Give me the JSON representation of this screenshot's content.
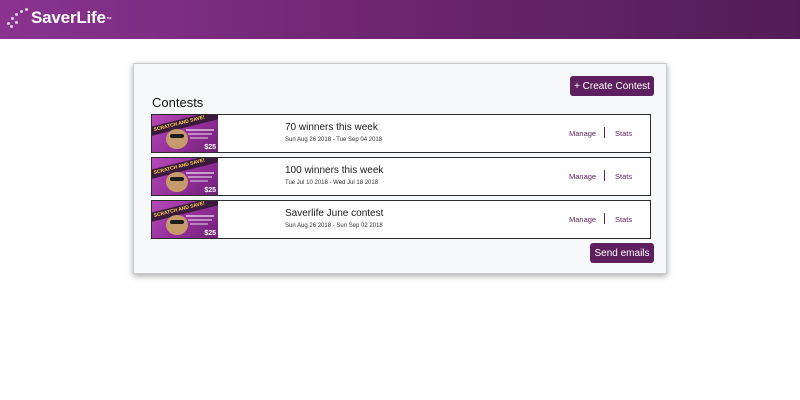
{
  "header": {
    "logo_text": "SaverLife",
    "logo_tm": "™",
    "brand_color": "#6f2672"
  },
  "main": {
    "title": "Contests",
    "create_button_label": "+ Create Contest",
    "send_button_label": "Send emails",
    "accent_color": "#5d1f5d"
  },
  "contests": [
    {
      "name": "70 winners this week",
      "dates": "Sun Aug 26 2018 - Tue Sep 04 2018",
      "thumb_banner": "SCRATCH AND SAVE!",
      "thumb_price": "$25",
      "manage_label": "Manage",
      "stats_label": "Stats"
    },
    {
      "name": "100 winners this week",
      "dates": "Tue Jul 10 2018 - Wed Jul 18 2018",
      "thumb_banner": "SCRATCH AND SAVE!",
      "thumb_price": "$25",
      "manage_label": "Manage",
      "stats_label": "Stats"
    },
    {
      "name": "Saverlife June contest",
      "dates": "Sun Aug 26 2018 - Sun Sep 02 2018",
      "thumb_banner": "SCRATCH AND SAVE!",
      "thumb_price": "$25",
      "manage_label": "Manage",
      "stats_label": "Stats"
    }
  ]
}
